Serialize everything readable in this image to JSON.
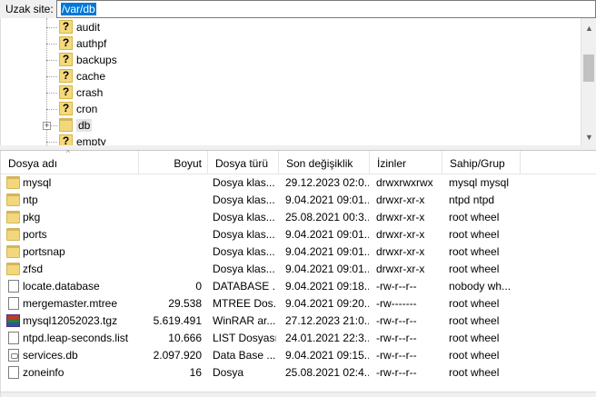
{
  "remote_site": {
    "label": "Uzak site:",
    "path": "/var/db"
  },
  "tree": {
    "items": [
      {
        "label": "audit",
        "icon": "unknown-folder-icon"
      },
      {
        "label": "authpf",
        "icon": "unknown-folder-icon"
      },
      {
        "label": "backups",
        "icon": "unknown-folder-icon"
      },
      {
        "label": "cache",
        "icon": "unknown-folder-icon"
      },
      {
        "label": "crash",
        "icon": "unknown-folder-icon"
      },
      {
        "label": "cron",
        "icon": "unknown-folder-icon"
      },
      {
        "label": "db",
        "icon": "folder-icon",
        "expander": "+"
      },
      {
        "label": "empty",
        "icon": "unknown-folder-icon"
      }
    ]
  },
  "file_list": {
    "columns": {
      "name": "Dosya adı",
      "size": "Boyut",
      "type": "Dosya türü",
      "modified": "Son değişiklik",
      "permissions": "İzinler",
      "owner": "Sahip/Grup"
    },
    "sort_indicator": "^",
    "rows": [
      {
        "name": "mysql",
        "size": "",
        "type": "Dosya klas...",
        "modified": "29.12.2023 02:0...",
        "permissions": "drwxrwxrwx",
        "owner": "mysql mysql",
        "icon": "folder-icon"
      },
      {
        "name": "ntp",
        "size": "",
        "type": "Dosya klas...",
        "modified": "9.04.2021 09:01...",
        "permissions": "drwxr-xr-x",
        "owner": "ntpd ntpd",
        "icon": "folder-icon"
      },
      {
        "name": "pkg",
        "size": "",
        "type": "Dosya klas...",
        "modified": "25.08.2021 00:3...",
        "permissions": "drwxr-xr-x",
        "owner": "root wheel",
        "icon": "folder-icon"
      },
      {
        "name": "ports",
        "size": "",
        "type": "Dosya klas...",
        "modified": "9.04.2021 09:01...",
        "permissions": "drwxr-xr-x",
        "owner": "root wheel",
        "icon": "folder-icon"
      },
      {
        "name": "portsnap",
        "size": "",
        "type": "Dosya klas...",
        "modified": "9.04.2021 09:01...",
        "permissions": "drwxr-xr-x",
        "owner": "root wheel",
        "icon": "folder-icon"
      },
      {
        "name": "zfsd",
        "size": "",
        "type": "Dosya klas...",
        "modified": "9.04.2021 09:01...",
        "permissions": "drwxr-xr-x",
        "owner": "root wheel",
        "icon": "folder-icon"
      },
      {
        "name": "locate.database",
        "size": "0",
        "type": "DATABASE ...",
        "modified": "9.04.2021 09:18...",
        "permissions": "-rw-r--r--",
        "owner": "nobody wh...",
        "icon": "file-icon"
      },
      {
        "name": "mergemaster.mtree",
        "size": "29.538",
        "type": "MTREE Dos...",
        "modified": "9.04.2021 09:20...",
        "permissions": "-rw-------",
        "owner": "root wheel",
        "icon": "file-icon"
      },
      {
        "name": "mysql12052023.tgz",
        "size": "5.619.491",
        "type": "WinRAR ar...",
        "modified": "27.12.2023 21:0...",
        "permissions": "-rw-r--r--",
        "owner": "root wheel",
        "icon": "winrar-archive-icon"
      },
      {
        "name": "ntpd.leap-seconds.list",
        "size": "10.666",
        "type": "LIST Dosyası",
        "modified": "24.01.2021 22:3...",
        "permissions": "-rw-r--r--",
        "owner": "root wheel",
        "icon": "file-icon"
      },
      {
        "name": "services.db",
        "size": "2.097.920",
        "type": "Data Base ...",
        "modified": "9.04.2021 09:15...",
        "permissions": "-rw-r--r--",
        "owner": "root wheel",
        "icon": "database-file-icon"
      },
      {
        "name": "zoneinfo",
        "size": "16",
        "type": "Dosya",
        "modified": "25.08.2021 02:4...",
        "permissions": "-rw-r--r--",
        "owner": "root wheel",
        "icon": "file-icon"
      }
    ]
  },
  "colors": {
    "selection": "#0078d7",
    "folder": "#f3d77c"
  }
}
